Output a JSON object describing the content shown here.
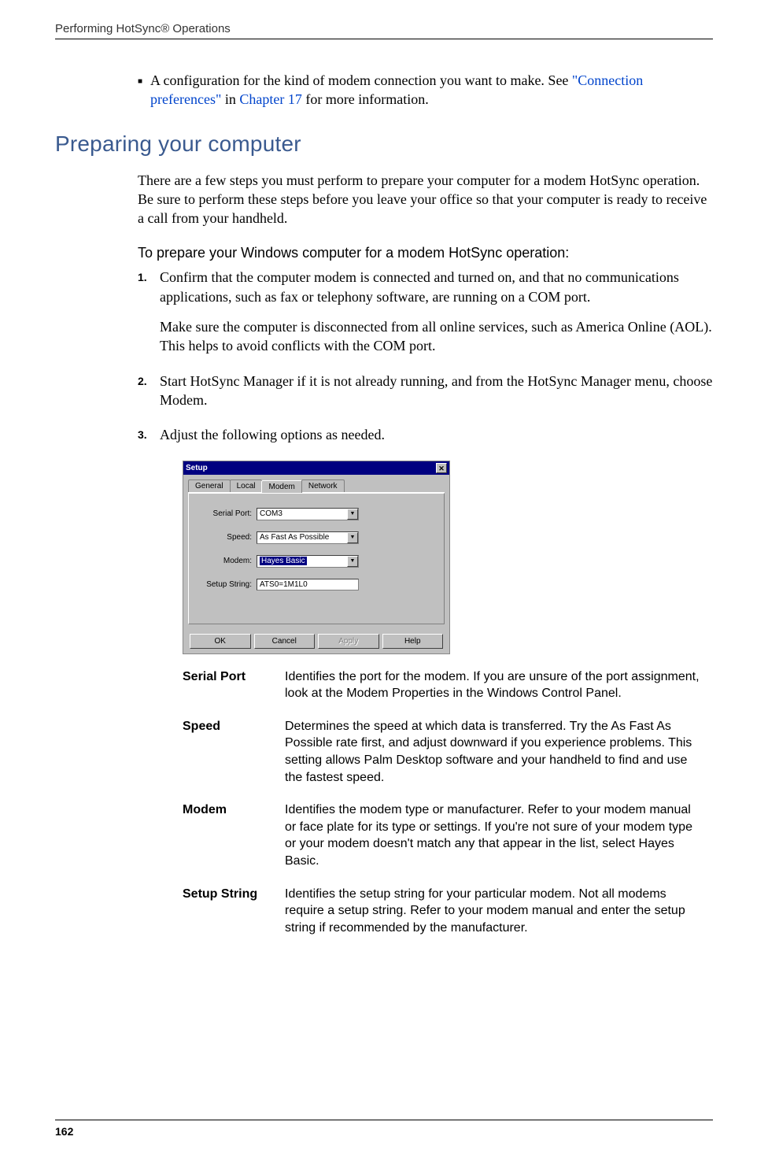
{
  "header": {
    "title": "Performing HotSync® Operations"
  },
  "bullet": {
    "pre": "A configuration for the kind of modem connection you want to make. See ",
    "link1": "\"Connection preferences\"",
    "mid": " in ",
    "link2": "Chapter 17",
    "post": " for more information."
  },
  "section": {
    "heading": "Preparing your computer",
    "intro": "There are a few steps you must perform to prepare your computer for a modem HotSync operation. Be sure to perform these steps before you leave your office so that your computer is ready to receive a call from your handheld.",
    "subheading": "To prepare your Windows computer for a modem HotSync operation:"
  },
  "steps": [
    {
      "n": "1.",
      "text": "Confirm that the computer modem is connected and turned on, and that no communications applications, such as fax or telephony software, are running on a COM port."
    },
    {
      "n": "2.",
      "text": "Start HotSync Manager if it is not already running, and from the HotSync Manager menu, choose Modem."
    },
    {
      "n": "3.",
      "text": "Adjust the following options as needed."
    }
  ],
  "step1_note": "Make sure the computer is disconnected from all online services, such as America Online (AOL). This helps to avoid conflicts with the COM port.",
  "dialog": {
    "title": "Setup",
    "tabs": [
      "General",
      "Local",
      "Modem",
      "Network"
    ],
    "fields": {
      "serial_label": "Serial Port:",
      "serial_value": "COM3",
      "speed_label": "Speed:",
      "speed_value": "As Fast As Possible",
      "modem_label": "Modem:",
      "modem_value": "Hayes Basic",
      "setup_label": "Setup String:",
      "setup_value": "ATS0=1M1L0"
    },
    "buttons": {
      "ok": "OK",
      "cancel": "Cancel",
      "apply": "Apply",
      "help": "Help"
    }
  },
  "defs": [
    {
      "term": "Serial Port",
      "desc": "Identifies the port for the modem. If you are unsure of the port assignment, look at the Modem Properties in the Windows Control Panel."
    },
    {
      "term": "Speed",
      "desc": "Determines the speed at which data is transferred. Try the As Fast As Possible rate first, and adjust downward if you experience problems. This setting allows Palm Desktop software and your handheld to find and use the fastest speed."
    },
    {
      "term": "Modem",
      "desc": "Identifies the modem type or manufacturer. Refer to your modem manual or face plate for its type or settings. If you're not sure of your modem type or your modem doesn't match any that appear in the list, select Hayes Basic."
    },
    {
      "term": "Setup String",
      "desc": "Identifies the setup string for your particular modem. Not all modems require a setup string. Refer to your modem manual and enter the setup string if recommended by the manufacturer."
    }
  ],
  "page": "162"
}
